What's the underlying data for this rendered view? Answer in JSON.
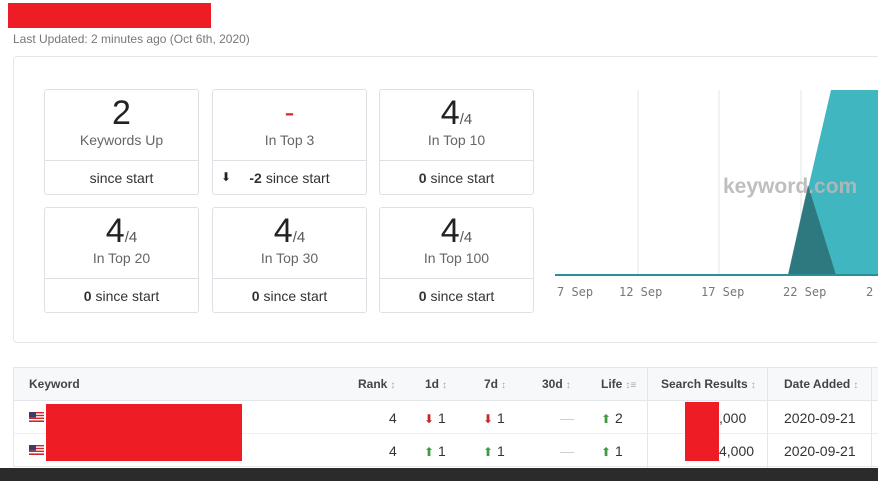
{
  "header": {
    "last_updated": "Last Updated: 2 minutes ago (Oct 6th, 2020)"
  },
  "colors": {
    "redaction": "#ee1c25",
    "chart_fill": "#36b2bd",
    "up": "#3f9c3f",
    "down": "#c62828"
  },
  "stats": [
    {
      "value": "2",
      "sub": "",
      "label": "Keywords Up",
      "change_value": "",
      "change_text": "since start",
      "arrow": ""
    },
    {
      "value": "-",
      "sub": "",
      "label": "In Top 3",
      "change_value": "-2",
      "change_text": "since start",
      "arrow": "down"
    },
    {
      "value": "4",
      "sub": "/4",
      "label": "In Top 10",
      "change_value": "0",
      "change_text": "since start",
      "arrow": ""
    },
    {
      "value": "4",
      "sub": "/4",
      "label": "In Top 20",
      "change_value": "0",
      "change_text": "since start",
      "arrow": ""
    },
    {
      "value": "4",
      "sub": "/4",
      "label": "In Top 30",
      "change_value": "0",
      "change_text": "since start",
      "arrow": ""
    },
    {
      "value": "4",
      "sub": "/4",
      "label": "In Top 100",
      "change_value": "0",
      "change_text": "since start",
      "arrow": ""
    }
  ],
  "chart": {
    "watermark": "keyword.com",
    "x_ticks": [
      "7 Sep",
      "12 Sep",
      "17 Sep",
      "22 Sep",
      "2"
    ]
  },
  "table": {
    "headers": {
      "keyword": "Keyword",
      "rank": "Rank",
      "d1": "1d",
      "d7": "7d",
      "d30": "30d",
      "life": "Life",
      "search_results": "Search Results",
      "date_added": "Date Added"
    },
    "rows": [
      {
        "rank": "4",
        "d1": "1",
        "d1_dir": "down",
        "d7": "1",
        "d7_dir": "down",
        "d30": "—",
        "life": "2",
        "life_dir": "up",
        "search_results": ",000",
        "date_added": "2020-09-21"
      },
      {
        "rank": "4",
        "d1": "1",
        "d1_dir": "up",
        "d7": "1",
        "d7_dir": "up",
        "d30": "—",
        "life": "1",
        "life_dir": "up",
        "search_results": "4,000",
        "date_added": "2020-09-21"
      }
    ]
  }
}
